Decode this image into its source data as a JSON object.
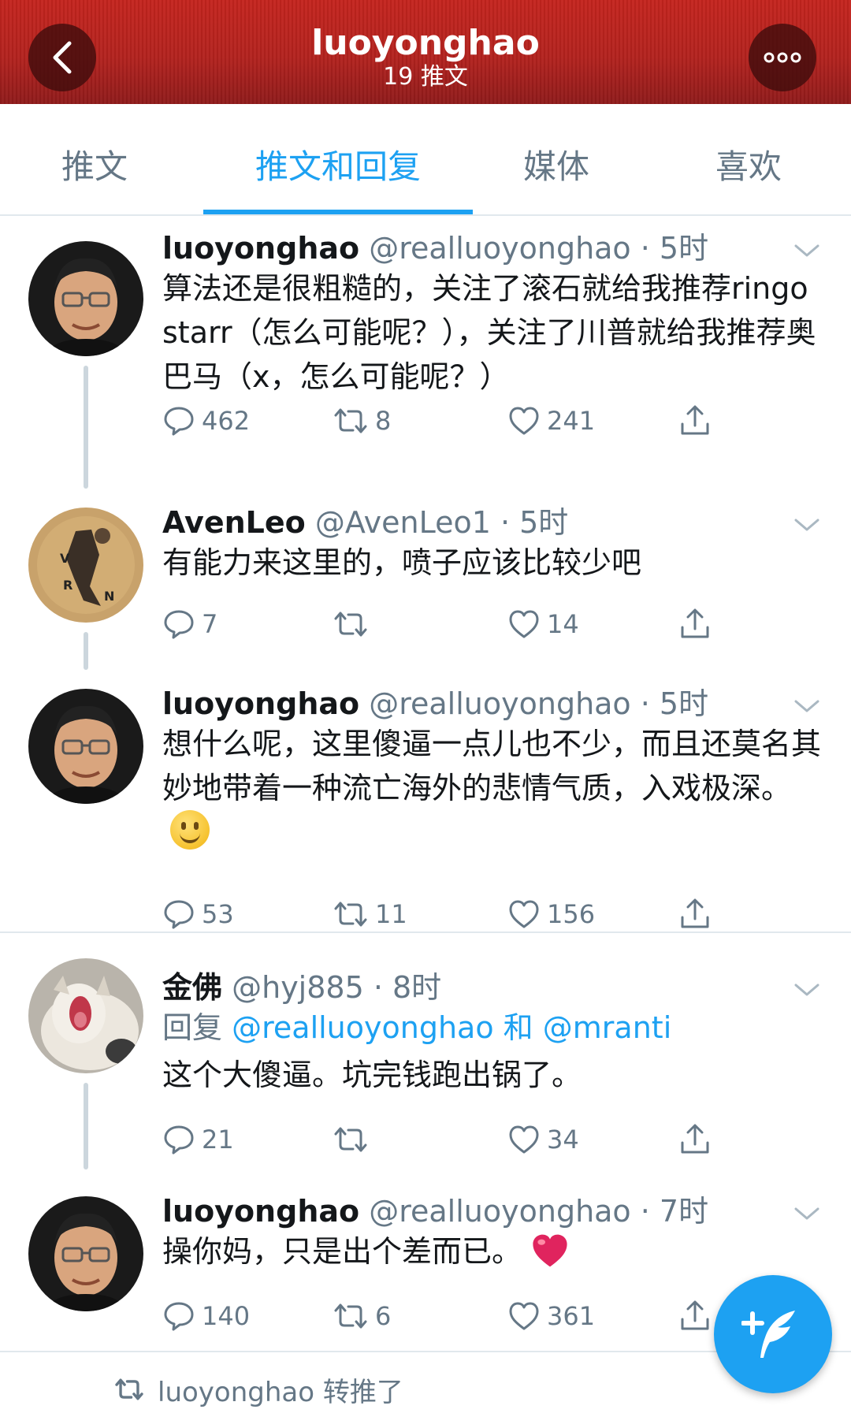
{
  "header": {
    "title": "luoyonghao",
    "subtitle": "19 推文",
    "back_icon": "chevron-left-icon",
    "more_icon": "more-dots-icon"
  },
  "tabs": [
    {
      "label": "推文",
      "active": false
    },
    {
      "label": "推文和回复",
      "active": true
    },
    {
      "label": "媒体",
      "active": false
    },
    {
      "label": "喜欢",
      "active": false
    }
  ],
  "tweets": [
    {
      "name": "luoyonghao",
      "meta": "@realluoyonghao · 5时",
      "text": "算法还是很粗糙的，关注了滚石就给我推荐ringo starr（怎么可能呢？），关注了川普就给我推荐奥巴马（x，怎么可能呢？）",
      "replies": "462",
      "retweets": "8",
      "likes": "241"
    },
    {
      "name": "AvenLeo",
      "meta": "@AvenLeo1 · 5时",
      "text": "有能力来这里的，喷子应该比较少吧",
      "replies": "7",
      "retweets": "",
      "likes": "14"
    },
    {
      "name": "luoyonghao",
      "meta": "@realluoyonghao · 5时",
      "text": "想什么呢，这里傻逼一点儿也不少，而且还莫名其妙地带着一种流亡海外的悲情气质，入戏极深。",
      "emoji": "slightly-smiling-face",
      "replies": "53",
      "retweets": "11",
      "likes": "156"
    },
    {
      "name": "金佛",
      "meta": "@hyj885 · 8时",
      "reply_prefix": "回复",
      "reply_mention_1": "@realluoyonghao",
      "reply_and": "和",
      "reply_mention_2": "@mranti",
      "text": "这个大傻逼。坑完钱跑出锅了。",
      "replies": "21",
      "retweets": "",
      "likes": "34"
    },
    {
      "name": "luoyonghao",
      "meta": "@realluoyonghao · 7时",
      "text": "操你妈，只是出个差而已。",
      "emoji": "red-heart",
      "replies": "140",
      "retweets": "6",
      "likes": "361"
    }
  ],
  "retweet_context": {
    "label": "luoyonghao 转推了"
  },
  "colors": {
    "header_red": "#b3221e",
    "accent_blue": "#1da1f2",
    "secondary_text": "#657786",
    "divider": "#e1e8ed"
  }
}
